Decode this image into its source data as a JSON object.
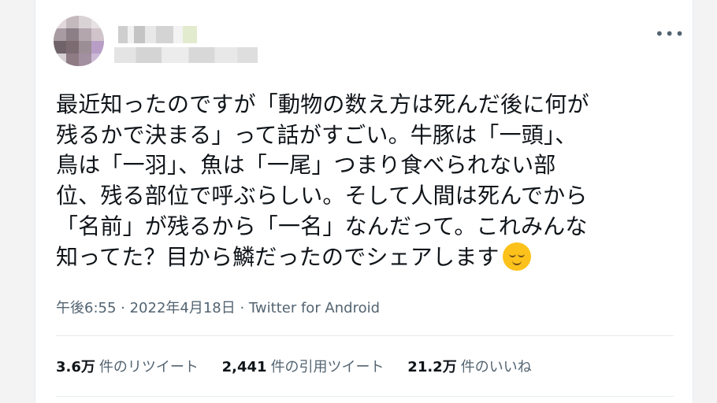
{
  "tweet": {
    "text_lines": [
      "最近知ったのですが「動物の数え方は死んだ後に何が",
      "残るかで決まる」って話がすごい。牛豚は「一頭」、",
      "鳥は「一羽」、魚は「一尾」つまり食べられない部",
      "位、残る部位で呼ぶらしい。そして人間は死んでから",
      "「名前」が残るから「一名」なんだって。これみんな",
      "知ってた？目から鱗だったのでシェアします"
    ],
    "emoji": "relieved-face",
    "timestamp": "午後6:55 · 2022年4月18日 · Twitter for Android",
    "more_icon": "more-icon"
  },
  "stats": {
    "retweets": {
      "count": "3.6万",
      "label": "件のリツイート"
    },
    "quotes": {
      "count": "2,441",
      "label": "件の引用ツイート"
    },
    "likes": {
      "count": "21.2万",
      "label": "件のいいね"
    }
  },
  "colors": {
    "text": "#0f1419",
    "secondary": "#536471",
    "divider": "#e6ecf0",
    "background": "#f3f3f3"
  }
}
